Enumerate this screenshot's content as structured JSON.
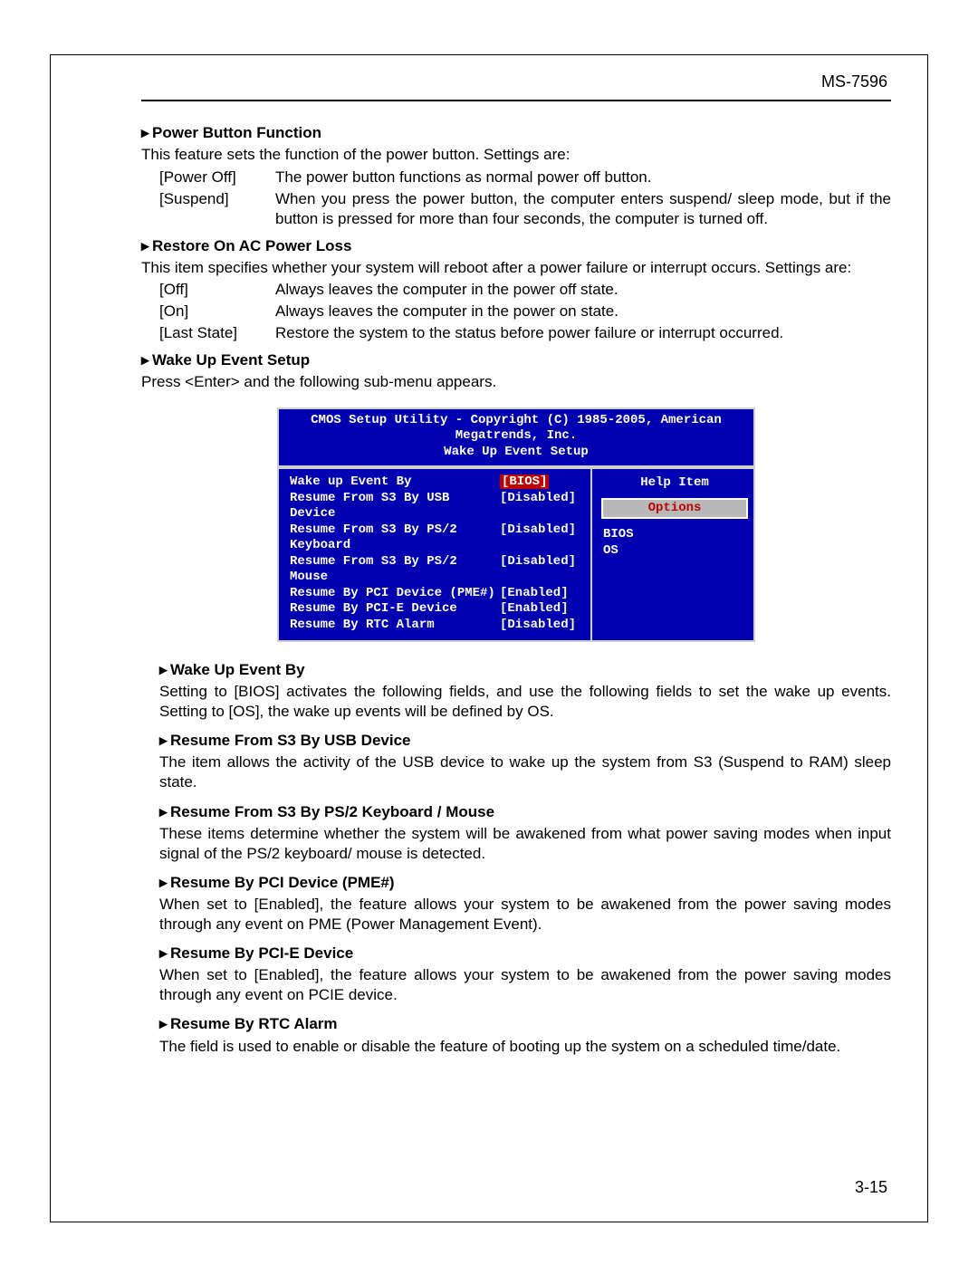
{
  "header": {
    "model": "MS-7596"
  },
  "footer": {
    "page": "3-15"
  },
  "marker": "▸",
  "s1": {
    "title": "Power Button Function",
    "intro": "This feature sets the function of the power button. Settings are:",
    "rows": [
      {
        "opt": "[Power Off]",
        "desc": "The power button functions as normal power off button."
      },
      {
        "opt": "[Suspend]",
        "desc": "When you press the power button, the computer enters suspend/ sleep mode, but if the button is pressed for more than four seconds, the computer is turned off."
      }
    ]
  },
  "s2": {
    "title": "Restore On AC Power Loss",
    "intro": "This item specifies whether your system will reboot after a power failure or interrupt occurs. Settings are:",
    "rows": [
      {
        "opt": "[Off]",
        "desc": "Always leaves the computer in the power off state."
      },
      {
        "opt": "[On]",
        "desc": "Always leaves the computer in the power on state."
      },
      {
        "opt": "[Last State]",
        "desc": "Restore the system to the status before power failure or interrupt occurred."
      }
    ]
  },
  "s3": {
    "title": "Wake Up Event Setup",
    "intro": "Press <Enter> and the following sub-menu appears."
  },
  "bios": {
    "title1": "CMOS Setup Utility - Copyright (C) 1985-2005, American Megatrends, Inc.",
    "title2": "Wake Up Event Setup",
    "rows": [
      {
        "k": "Wake up Event By",
        "v": "[BIOS]",
        "sel": true
      },
      {
        "k": "Resume From S3 By USB Device",
        "v": "[Disabled]",
        "sel": false
      },
      {
        "k": "Resume From S3 By PS/2 Keyboard",
        "v": "[Disabled]",
        "sel": false
      },
      {
        "k": "Resume From S3 By PS/2 Mouse",
        "v": "[Disabled]",
        "sel": false
      },
      {
        "k": "Resume By PCI Device (PME#)",
        "v": "[Enabled]",
        "sel": false
      },
      {
        "k": "Resume By PCI-E Device",
        "v": "[Enabled]",
        "sel": false
      },
      {
        "k": "Resume By RTC Alarm",
        "v": "[Disabled]",
        "sel": false
      }
    ],
    "help": "Help Item",
    "options": "Options",
    "opt1": "BIOS",
    "opt2": "OS"
  },
  "s4": {
    "title": "Wake Up Event By",
    "body": "Setting to [BIOS] activates the following fields, and use the following fields to set the wake up events. Setting to [OS], the wake up events will be defined by OS."
  },
  "s5": {
    "title": "Resume From S3 By USB Device",
    "body": "The item allows the activity of the USB device to wake up the system from S3 (Suspend to RAM) sleep state."
  },
  "s6": {
    "title": "Resume From S3 By PS/2 Keyboard / Mouse",
    "body": "These items determine whether the system will be awakened from what power saving modes when input signal of the PS/2 keyboard/ mouse is detected."
  },
  "s7": {
    "title": "Resume By PCI Device (PME#)",
    "body": "When set to [Enabled], the feature allows your system to be awakened from the power saving modes through any event on PME (Power Management Event)."
  },
  "s8": {
    "title": "Resume By PCI-E Device",
    "body": "When set to [Enabled], the feature allows your system to be awakened from the power saving modes through any event on PCIE device."
  },
  "s9": {
    "title": "Resume By RTC Alarm",
    "body": "The field is used to enable or disable the feature of booting up the system on a scheduled time/date."
  }
}
